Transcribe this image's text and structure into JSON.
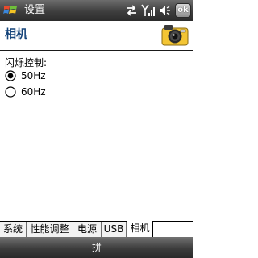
{
  "titlebar": {
    "title": "设置",
    "start_icon": "windows-flag-icon",
    "status_icons": [
      "connectivity-icon",
      "signal-icon",
      "volume-icon"
    ],
    "ok_label": "ok"
  },
  "page": {
    "title": "相机",
    "header_icon": "camera-icon"
  },
  "setting": {
    "label": "闪烁控制:",
    "options": [
      {
        "label": "50Hz",
        "selected": true
      },
      {
        "label": "60Hz",
        "selected": false
      }
    ]
  },
  "tabs": [
    {
      "label": "系统",
      "active": false
    },
    {
      "label": "性能调整",
      "active": false
    },
    {
      "label": "电源",
      "active": false
    },
    {
      "label": "USB",
      "active": false
    },
    {
      "label": "相机",
      "active": true
    }
  ],
  "bottombar": {
    "input_method": "拼"
  },
  "colors": {
    "page_title": "#15447a",
    "bars": "#3e3e3e"
  }
}
